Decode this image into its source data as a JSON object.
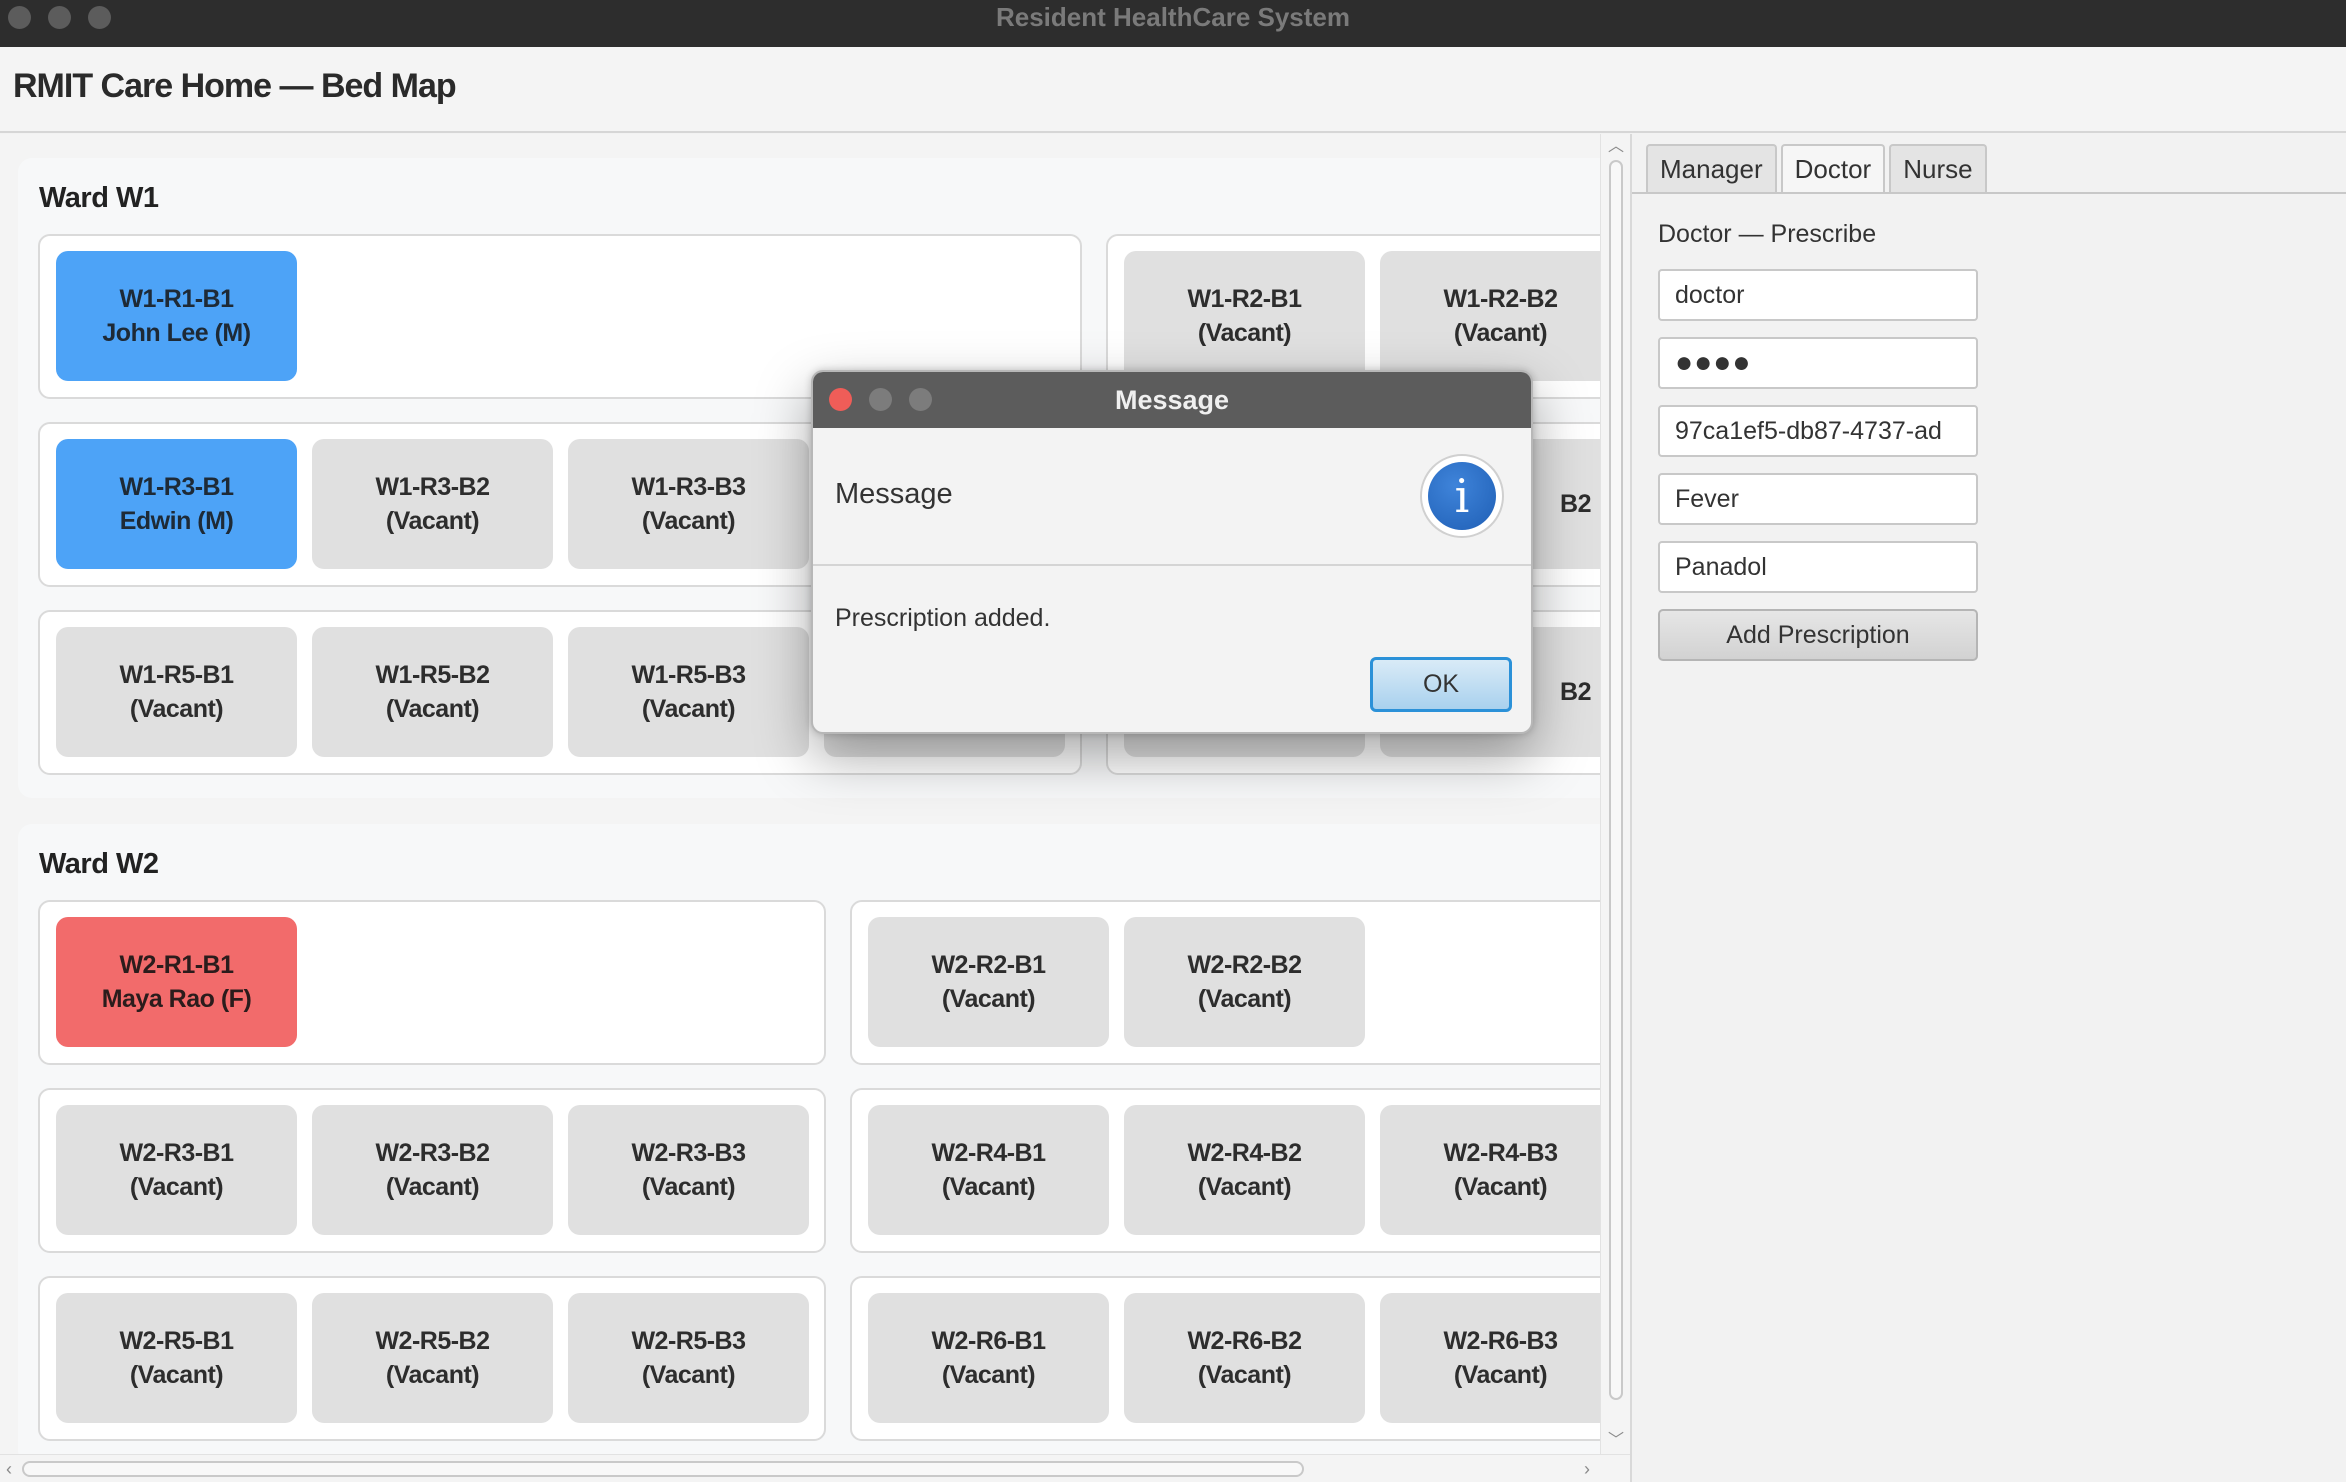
{
  "window": {
    "title": "Resident HealthCare System"
  },
  "header": {
    "title": "RMIT Care Home — Bed Map"
  },
  "wards": [
    {
      "title": "Ward W1",
      "rooms": [
        {
          "beds": [
            {
              "line1": "W1-R1-B1",
              "line2": "John Lee (M)",
              "status": "male"
            }
          ]
        },
        {
          "beds": [
            {
              "line1": "W1-R2-B1",
              "line2": "(Vacant)",
              "status": "vacant"
            },
            {
              "line1": "W1-R2-B2",
              "line2": "(Vacant)",
              "status": "vacant"
            }
          ]
        },
        {
          "beds": [
            {
              "line1": "W1-R3-B1",
              "line2": "Edwin (M)",
              "status": "male"
            },
            {
              "line1": "W1-R3-B2",
              "line2": "(Vacant)",
              "status": "vacant"
            },
            {
              "line1": "W1-R3-B3",
              "line2": "(Vacant)",
              "status": "vacant"
            }
          ]
        },
        {
          "beds": [
            {
              "line1": "B2",
              "line2": "",
              "status": "vacant"
            }
          ]
        },
        {
          "beds": [
            {
              "line1": "W1-R5-B1",
              "line2": "(Vacant)",
              "status": "vacant"
            },
            {
              "line1": "W1-R5-B2",
              "line2": "(Vacant)",
              "status": "vacant"
            },
            {
              "line1": "W1-R5-B3",
              "line2": "(Vacant)",
              "status": "vacant"
            }
          ]
        },
        {
          "beds": [
            {
              "line1": "B2",
              "line2": "",
              "status": "vacant"
            }
          ]
        }
      ]
    },
    {
      "title": "Ward W2",
      "rooms": [
        {
          "beds": [
            {
              "line1": "W2-R1-B1",
              "line2": "Maya Rao (F)",
              "status": "female"
            }
          ]
        },
        {
          "beds": [
            {
              "line1": "W2-R2-B1",
              "line2": "(Vacant)",
              "status": "vacant"
            },
            {
              "line1": "W2-R2-B2",
              "line2": "(Vacant)",
              "status": "vacant"
            }
          ]
        },
        {
          "beds": [
            {
              "line1": "W2-R3-B1",
              "line2": "(Vacant)",
              "status": "vacant"
            },
            {
              "line1": "W2-R3-B2",
              "line2": "(Vacant)",
              "status": "vacant"
            },
            {
              "line1": "W2-R3-B3",
              "line2": "(Vacant)",
              "status": "vacant"
            }
          ]
        },
        {
          "beds": [
            {
              "line1": "W2-R4-B1",
              "line2": "(Vacant)",
              "status": "vacant"
            },
            {
              "line1": "W2-R4-B2",
              "line2": "(Vacant)",
              "status": "vacant"
            },
            {
              "line1": "W2-R4-B3",
              "line2": "(Vacant)",
              "status": "vacant"
            }
          ]
        },
        {
          "beds": [
            {
              "line1": "W2-R5-B1",
              "line2": "(Vacant)",
              "status": "vacant"
            },
            {
              "line1": "W2-R5-B2",
              "line2": "(Vacant)",
              "status": "vacant"
            },
            {
              "line1": "W2-R5-B3",
              "line2": "(Vacant)",
              "status": "vacant"
            }
          ]
        },
        {
          "beds": [
            {
              "line1": "W2-R6-B1",
              "line2": "(Vacant)",
              "status": "vacant"
            },
            {
              "line1": "W2-R6-B2",
              "line2": "(Vacant)",
              "status": "vacant"
            },
            {
              "line1": "W2-R6-B3",
              "line2": "(Vacant)",
              "status": "vacant"
            }
          ]
        }
      ]
    }
  ],
  "side_panel": {
    "tabs": [
      {
        "label": "Manager",
        "active": false
      },
      {
        "label": "Doctor",
        "active": true
      },
      {
        "label": "Nurse",
        "active": false
      }
    ],
    "section_title": "Doctor — Prescribe",
    "fields": {
      "username": "doctor",
      "password_mask": "●●●●",
      "resident_id": "97ca1ef5-db87-4737-ad",
      "condition": "Fever",
      "medicine": "Panadol"
    },
    "add_button": "Add Prescription"
  },
  "dialog": {
    "title": "Message",
    "header": "Message",
    "icon": "info-icon",
    "icon_glyph": "i",
    "message": "Prescription added.",
    "ok_label": "OK"
  },
  "colors": {
    "male_bed": "#4da3f7",
    "female_bed": "#f26b6b",
    "vacant_bed": "#e0e0e0",
    "close_button": "#ef5d58",
    "ok_border": "#2b91d8"
  }
}
